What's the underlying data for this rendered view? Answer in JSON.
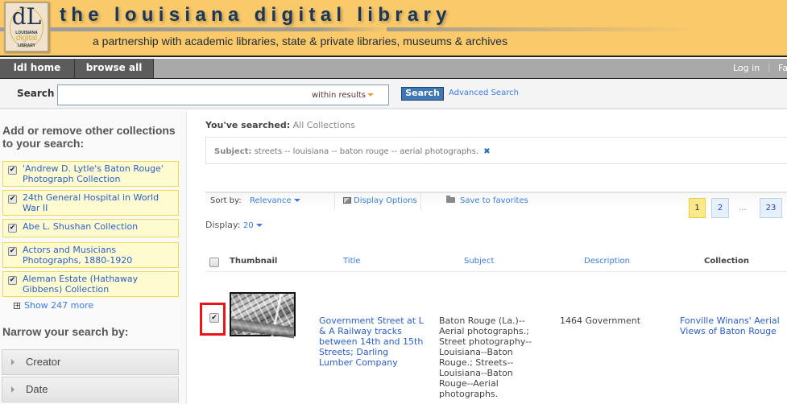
{
  "header": {
    "logo": {
      "monogram": "dL",
      "line1": "LOUISIANA",
      "line2": "digital",
      "line3": "LIBRARY"
    },
    "title": "the louisiana digital library",
    "tagline": "a partnership with academic libraries, state & private libraries, museums & archives"
  },
  "nav": {
    "items": [
      {
        "label": "ldl home"
      },
      {
        "label": "browse all"
      }
    ],
    "login": "Log in",
    "separator": "|",
    "favorites_partial": "Fa"
  },
  "search": {
    "label": "Search",
    "value": "",
    "scope": "within results",
    "button": "Search",
    "advanced": "Advanced Search"
  },
  "sidebar": {
    "collections_heading": "Add or remove other collections to your search:",
    "collections": [
      {
        "label": "'Andrew D. Lytle's Baton Rouge' Photograph Collection",
        "checked": true
      },
      {
        "label": "24th General Hospital in World War II",
        "checked": true
      },
      {
        "label": "Abe L. Shushan Collection",
        "checked": true
      },
      {
        "label": "Actors and Musicians Photographs, 1880-1920",
        "checked": true
      },
      {
        "label": "Aleman Estate (Hathaway Gibbens) Collection",
        "checked": true
      }
    ],
    "show_more": "Show 247 more",
    "narrow_heading": "Narrow your search by:",
    "facets": [
      {
        "label": "Creator"
      },
      {
        "label": "Date"
      }
    ]
  },
  "main": {
    "searched_label": "You've searched:",
    "searched_value": "All Collections",
    "filter": {
      "field": "Subject:",
      "value": "streets -- louisiana -- baton rouge -- aerial photographs.",
      "remove_icon": "✖"
    },
    "toolbar": {
      "sort_label": "Sort by:",
      "sort_value": "Relevance",
      "display_options": "Display Options",
      "save_favorites": "Save to favorites"
    },
    "pagination": {
      "pages": [
        "1",
        "2",
        "23"
      ],
      "current": "1",
      "ellipsis": "..."
    },
    "display": {
      "label": "Display:",
      "value": "20"
    },
    "table": {
      "columns": [
        "Thumbnail",
        "Title",
        "Subject",
        "Description",
        "Collection"
      ],
      "rows": [
        {
          "checked": true,
          "title": "Government Street at L & A Railway tracks between 14th and 15th Streets; Darling Lumber Company",
          "subject": "Baton Rouge (La.)--Aerial photographs.; Street photography--Louisiana--Baton Rouge.; Streets--Louisiana--Baton Rouge--Aerial photographs.",
          "description": "1464 Government",
          "collection": "Fonville Winans' Aerial Views of Baton Rouge"
        }
      ]
    }
  },
  "colors": {
    "header_bg": "#f9c96a",
    "title_text": "#18375a",
    "nav_bg": "#a8a8a8",
    "nav_item_bg": "#5c5c5c",
    "link": "#3b7ce0",
    "search_button": "#3f77b3",
    "collection_bg": "#fffbd0",
    "collection_border": "#f0d94a",
    "current_page": "#fde98a",
    "highlight": "#e8141a"
  }
}
